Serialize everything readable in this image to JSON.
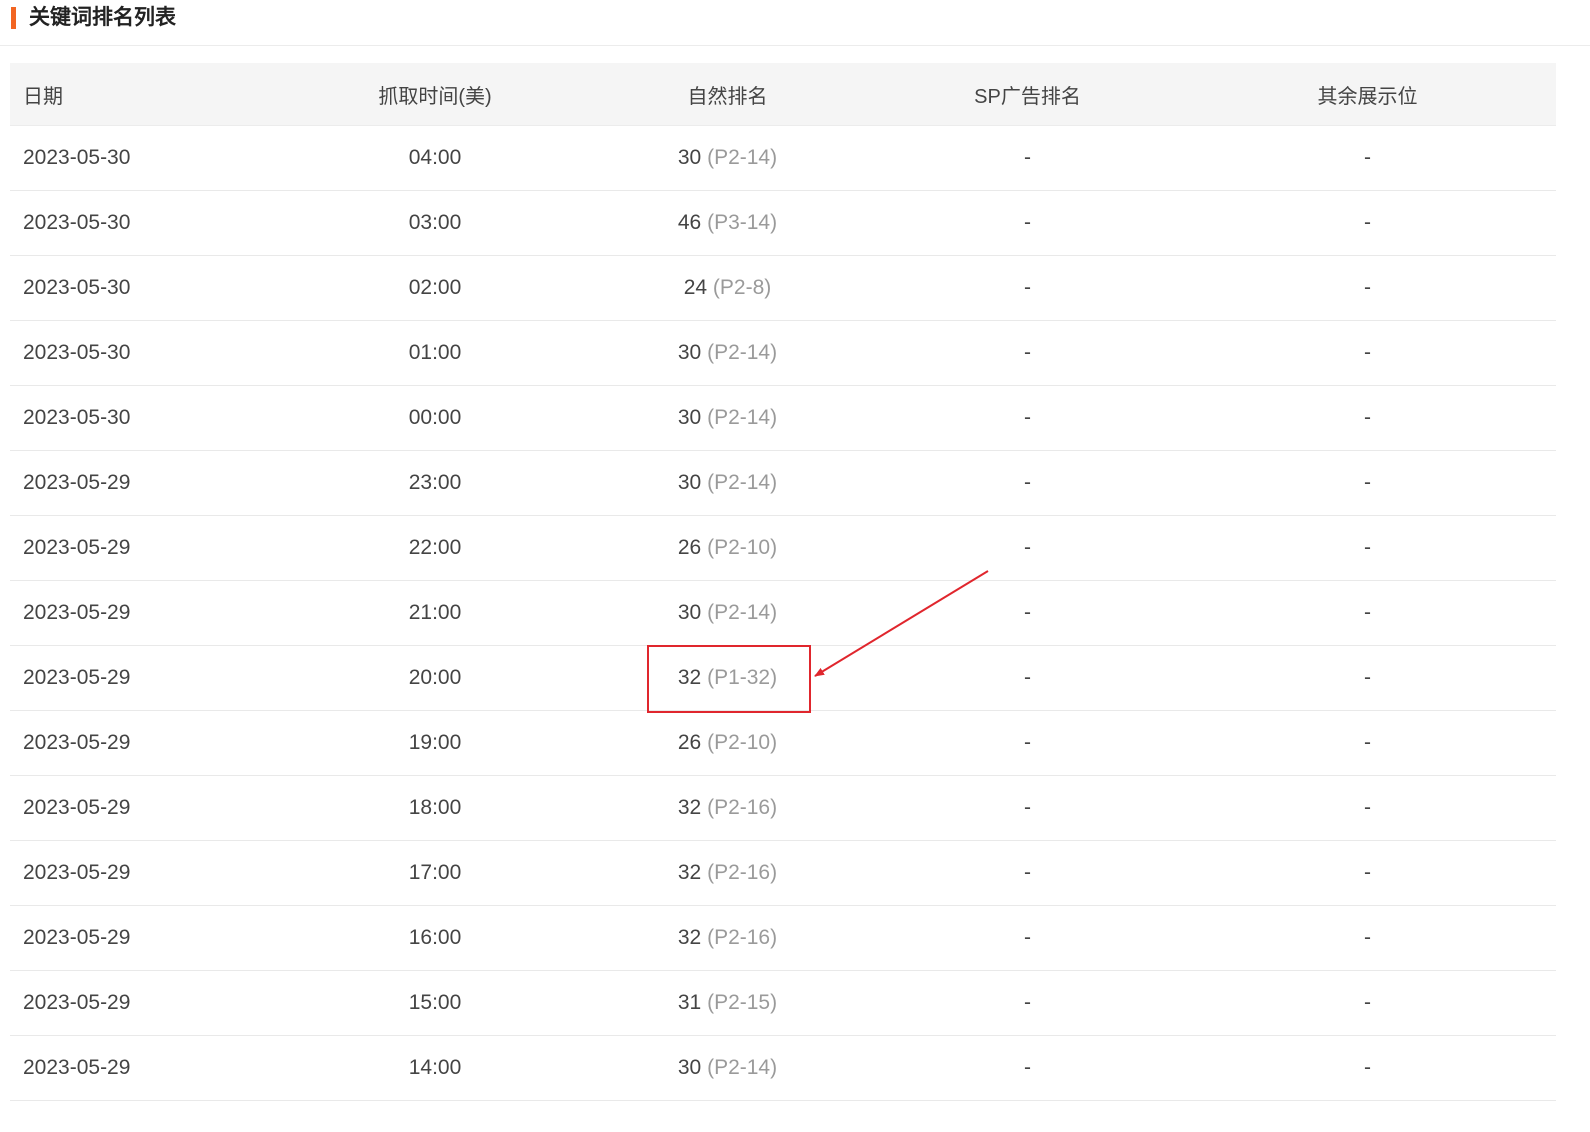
{
  "header": {
    "title": "关键词排名列表",
    "accent_color": "#f26522"
  },
  "table": {
    "columns": [
      "日期",
      "抓取时间(美)",
      "自然排名",
      "SP广告排名",
      "其余展示位"
    ],
    "rows": [
      {
        "date": "2023-05-30",
        "time": "04:00",
        "rank": "30",
        "pos": "(P2-14)",
        "sp": "-",
        "other": "-"
      },
      {
        "date": "2023-05-30",
        "time": "03:00",
        "rank": "46",
        "pos": "(P3-14)",
        "sp": "-",
        "other": "-"
      },
      {
        "date": "2023-05-30",
        "time": "02:00",
        "rank": "24",
        "pos": "(P2-8)",
        "sp": "-",
        "other": "-"
      },
      {
        "date": "2023-05-30",
        "time": "01:00",
        "rank": "30",
        "pos": "(P2-14)",
        "sp": "-",
        "other": "-"
      },
      {
        "date": "2023-05-30",
        "time": "00:00",
        "rank": "30",
        "pos": "(P2-14)",
        "sp": "-",
        "other": "-"
      },
      {
        "date": "2023-05-29",
        "time": "23:00",
        "rank": "30",
        "pos": "(P2-14)",
        "sp": "-",
        "other": "-"
      },
      {
        "date": "2023-05-29",
        "time": "22:00",
        "rank": "26",
        "pos": "(P2-10)",
        "sp": "-",
        "other": "-"
      },
      {
        "date": "2023-05-29",
        "time": "21:00",
        "rank": "30",
        "pos": "(P2-14)",
        "sp": "-",
        "other": "-"
      },
      {
        "date": "2023-05-29",
        "time": "20:00",
        "rank": "32",
        "pos": "(P1-32)",
        "sp": "-",
        "other": "-"
      },
      {
        "date": "2023-05-29",
        "time": "19:00",
        "rank": "26",
        "pos": "(P2-10)",
        "sp": "-",
        "other": "-"
      },
      {
        "date": "2023-05-29",
        "time": "18:00",
        "rank": "32",
        "pos": "(P2-16)",
        "sp": "-",
        "other": "-"
      },
      {
        "date": "2023-05-29",
        "time": "17:00",
        "rank": "32",
        "pos": "(P2-16)",
        "sp": "-",
        "other": "-"
      },
      {
        "date": "2023-05-29",
        "time": "16:00",
        "rank": "32",
        "pos": "(P2-16)",
        "sp": "-",
        "other": "-"
      },
      {
        "date": "2023-05-29",
        "time": "15:00",
        "rank": "31",
        "pos": "(P2-15)",
        "sp": "-",
        "other": "-"
      },
      {
        "date": "2023-05-29",
        "time": "14:00",
        "rank": "30",
        "pos": "(P2-14)",
        "sp": "-",
        "other": "-"
      }
    ]
  },
  "annotation": {
    "color": "#e0262d"
  }
}
